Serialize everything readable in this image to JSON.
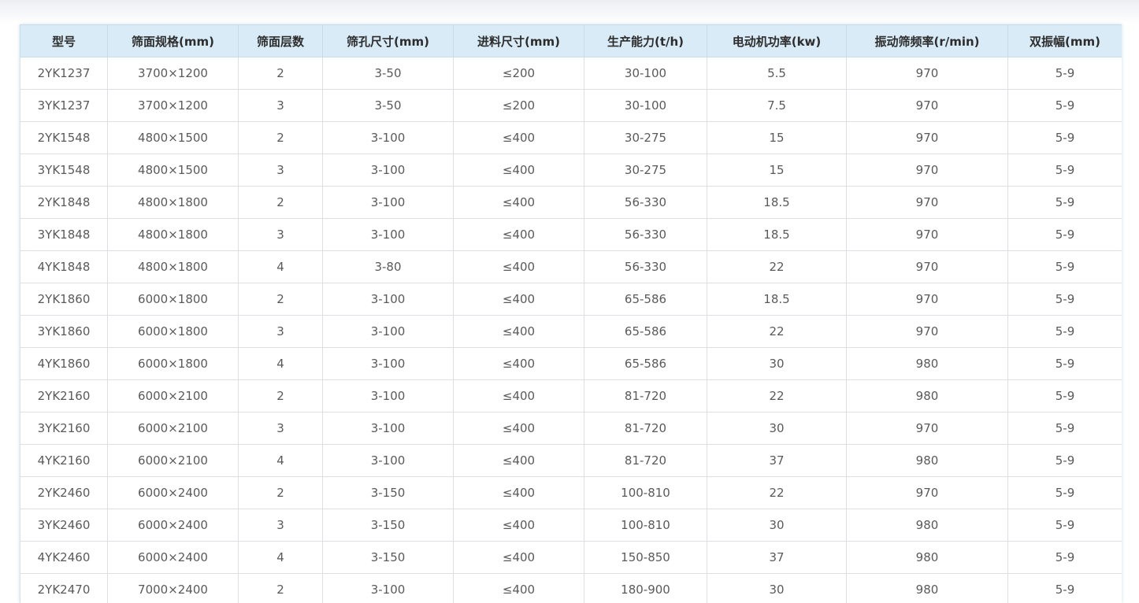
{
  "table": {
    "headers": [
      "型号",
      "筛面规格(mm)",
      "筛面层数",
      "筛孔尺寸(mm)",
      "进料尺寸(mm)",
      "生产能力(t/h)",
      "电动机功率(kw)",
      "振动筛频率(r/min)",
      "双振幅(mm)"
    ],
    "rows": [
      [
        "2YK1237",
        "3700×1200",
        "2",
        "3-50",
        "≤200",
        "30-100",
        "5.5",
        "970",
        "5-9"
      ],
      [
        "3YK1237",
        "3700×1200",
        "3",
        "3-50",
        "≤200",
        "30-100",
        "7.5",
        "970",
        "5-9"
      ],
      [
        "2YK1548",
        "4800×1500",
        "2",
        "3-100",
        "≤400",
        "30-275",
        "15",
        "970",
        "5-9"
      ],
      [
        "3YK1548",
        "4800×1500",
        "3",
        "3-100",
        "≤400",
        "30-275",
        "15",
        "970",
        "5-9"
      ],
      [
        "2YK1848",
        "4800×1800",
        "2",
        "3-100",
        "≤400",
        "56-330",
        "18.5",
        "970",
        "5-9"
      ],
      [
        "3YK1848",
        "4800×1800",
        "3",
        "3-100",
        "≤400",
        "56-330",
        "18.5",
        "970",
        "5-9"
      ],
      [
        "4YK1848",
        "4800×1800",
        "4",
        "3-80",
        "≤400",
        "56-330",
        "22",
        "970",
        "5-9"
      ],
      [
        "2YK1860",
        "6000×1800",
        "2",
        "3-100",
        "≤400",
        "65-586",
        "18.5",
        "970",
        "5-9"
      ],
      [
        "3YK1860",
        "6000×1800",
        "3",
        "3-100",
        "≤400",
        "65-586",
        "22",
        "970",
        "5-9"
      ],
      [
        "4YK1860",
        "6000×1800",
        "4",
        "3-100",
        "≤400",
        "65-586",
        "30",
        "980",
        "5-9"
      ],
      [
        "2YK2160",
        "6000×2100",
        "2",
        "3-100",
        "≤400",
        "81-720",
        "22",
        "980",
        "5-9"
      ],
      [
        "3YK2160",
        "6000×2100",
        "3",
        "3-100",
        "≤400",
        "81-720",
        "30",
        "970",
        "5-9"
      ],
      [
        "4YK2160",
        "6000×2100",
        "4",
        "3-100",
        "≤400",
        "81-720",
        "37",
        "980",
        "5-9"
      ],
      [
        "2YK2460",
        "6000×2400",
        "2",
        "3-150",
        "≤400",
        "100-810",
        "22",
        "970",
        "5-9"
      ],
      [
        "3YK2460",
        "6000×2400",
        "3",
        "3-150",
        "≤400",
        "100-810",
        "30",
        "980",
        "5-9"
      ],
      [
        "4YK2460",
        "6000×2400",
        "4",
        "3-150",
        "≤400",
        "150-850",
        "37",
        "980",
        "5-9"
      ],
      [
        "2YK2470",
        "7000×2400",
        "2",
        "3-100",
        "≤400",
        "180-900",
        "30",
        "980",
        "5-9"
      ]
    ]
  },
  "colors": {
    "header_bg": "#d8ebf6",
    "border": "#dcdfe3",
    "cell_text": "#5a5a5a",
    "header_text": "#2d2d2d"
  }
}
